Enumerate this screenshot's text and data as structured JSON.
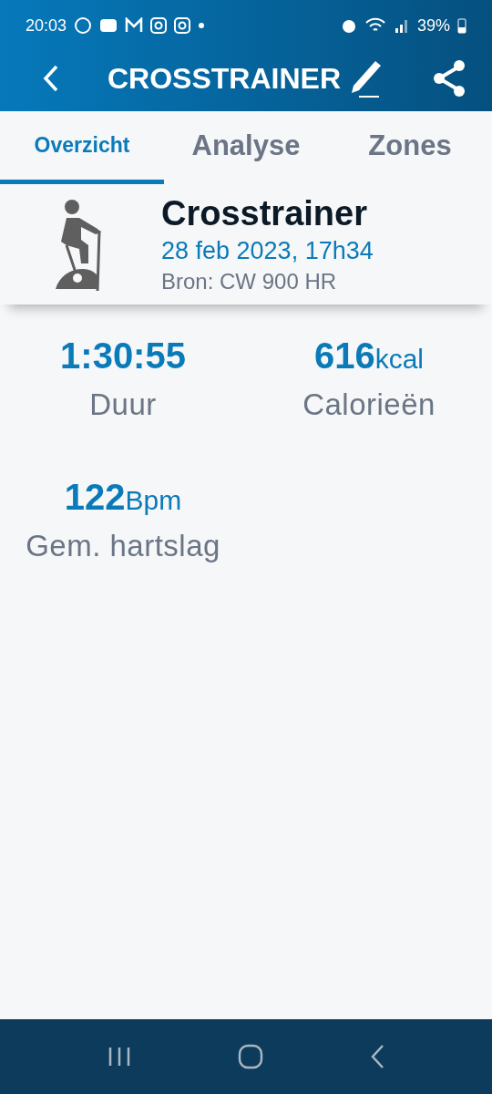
{
  "status_bar": {
    "time": "20:03",
    "battery": "39%"
  },
  "app_bar": {
    "title": "CROSSTRAINER"
  },
  "tabs": [
    {
      "label": "Overzicht",
      "selected": true
    },
    {
      "label": "Analyse",
      "selected": false
    },
    {
      "label": "Zones",
      "selected": false
    }
  ],
  "activity": {
    "name": "Crosstrainer",
    "date": "28 feb 2023, 17h34",
    "source": "Bron: CW 900 HR"
  },
  "stats": [
    {
      "value": "1:30:55",
      "label": "Duur"
    },
    {
      "value": "616",
      "unit": "kcal",
      "label": "Calorieën"
    },
    {
      "value": "122",
      "unit": "Bpm",
      "label": "Gem. hartslag"
    }
  ]
}
